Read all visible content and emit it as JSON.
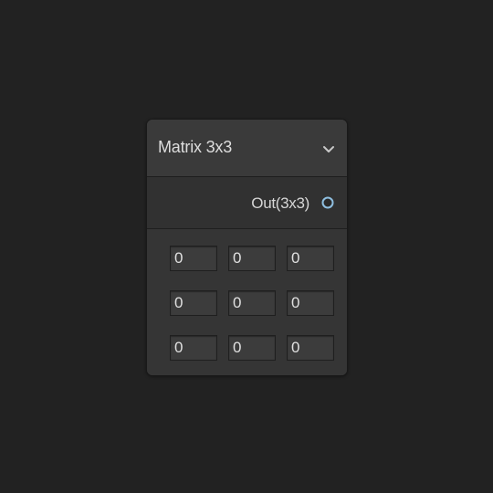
{
  "node": {
    "title": "Matrix 3x3",
    "collapse_icon": "chevron-down-icon",
    "output_port": {
      "label": "Out(3x3)",
      "color": "#8fbfe0"
    },
    "matrix": {
      "rows": [
        [
          "0",
          "0",
          "0"
        ],
        [
          "0",
          "0",
          "0"
        ],
        [
          "0",
          "0",
          "0"
        ]
      ]
    }
  },
  "colors": {
    "background": "#222222",
    "node_body": "#353535",
    "node_header": "#3a3a3a",
    "text": "#dddddd",
    "port_accent": "#8fbfe0"
  }
}
